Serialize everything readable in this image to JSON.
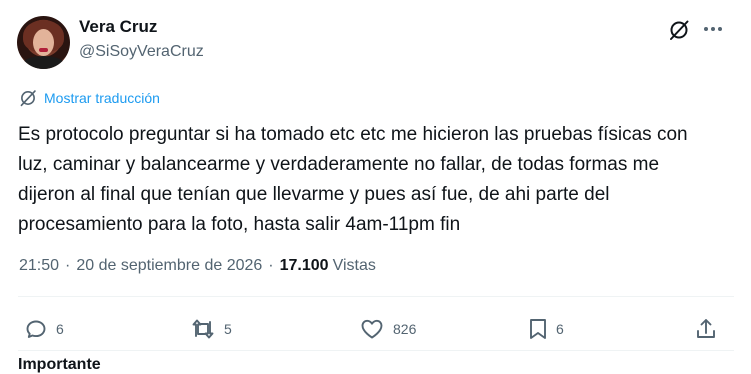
{
  "author": {
    "name": "Vera Cruz",
    "handle": "@SiSoyVeraCruz"
  },
  "translate_label": "Mostrar traducción",
  "tweet_text": "Es protocolo preguntar si ha tomado etc etc me hicieron las pruebas físicas con luz, caminar y balancearme y verdaderamente no fallar, de todas formas me dijeron al final que tenían que llevarme y pues así fue, de ahi parte del procesamiento para la foto, hasta salir 4am-11pm fin",
  "meta": {
    "time": "21:50",
    "separator": "·",
    "date": "20 de septiembre de 2026",
    "views_count": "17.100",
    "views_label": "Vistas"
  },
  "actions": {
    "replies": "6",
    "reposts": "5",
    "likes": "826",
    "bookmarks": "6"
  },
  "footer_partial": "Importante",
  "colors": {
    "link": "#1d9bf0",
    "text": "#0f1419",
    "secondary": "#536471",
    "divider": "#eff3f4"
  },
  "icons": [
    "grok-icon",
    "more-icon",
    "translate-icon",
    "reply-icon",
    "repost-icon",
    "like-icon",
    "bookmark-icon",
    "share-icon"
  ]
}
